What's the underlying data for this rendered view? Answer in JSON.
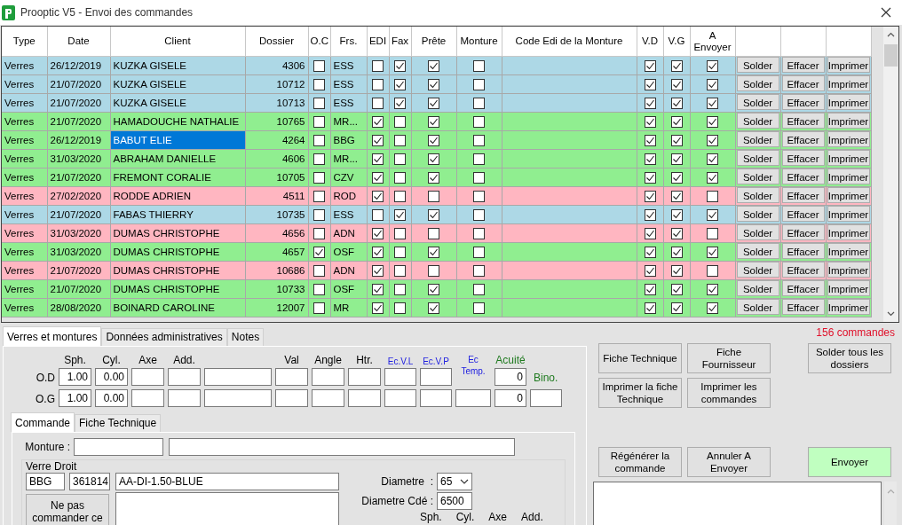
{
  "window": {
    "title": "Prooptic V5 - Envoi des commandes"
  },
  "table": {
    "columns": [
      "Type",
      "Date",
      "Client",
      "Dossier",
      "O.C",
      "Frs.",
      "EDI",
      "Fax",
      "Prête",
      "Monture",
      "Code Edi de la Monture",
      "V.D",
      "V.G",
      "A Envoyer"
    ],
    "rows": [
      {
        "type": "Verres",
        "date": "26/12/2019",
        "client": "KUZKA GISELE",
        "dossier": "4306",
        "oc": false,
        "frs": "ESS",
        "edi": false,
        "fax": true,
        "prete": true,
        "monture": false,
        "vd": true,
        "vg": true,
        "a_envoyer": true,
        "color": "#add8e6",
        "selected": false,
        "buttons": [
          "Solder",
          "Effacer",
          "Imprimer"
        ]
      },
      {
        "type": "Verres",
        "date": "21/07/2020",
        "client": "KUZKA GISELE",
        "dossier": "10712",
        "oc": false,
        "frs": "ESS",
        "edi": false,
        "fax": true,
        "prete": true,
        "monture": false,
        "vd": true,
        "vg": true,
        "a_envoyer": true,
        "color": "#add8e6",
        "selected": false,
        "buttons": [
          "Solder",
          "Effacer",
          "Imprimer"
        ]
      },
      {
        "type": "Verres",
        "date": "21/07/2020",
        "client": "KUZKA GISELE",
        "dossier": "10713",
        "oc": false,
        "frs": "ESS",
        "edi": false,
        "fax": true,
        "prete": true,
        "monture": false,
        "vd": true,
        "vg": true,
        "a_envoyer": true,
        "color": "#add8e6",
        "selected": false,
        "buttons": [
          "Solder",
          "Effacer",
          "Imprimer"
        ]
      },
      {
        "type": "Verres",
        "date": "21/07/2020",
        "client": "HAMADOUCHE NATHALIE",
        "dossier": "10765",
        "oc": false,
        "frs": "MR...",
        "edi": true,
        "fax": false,
        "prete": true,
        "monture": false,
        "vd": true,
        "vg": true,
        "a_envoyer": true,
        "color": "#90ee90",
        "selected": false,
        "buttons": [
          "Solder",
          "Effacer",
          "Imprimer"
        ]
      },
      {
        "type": "Verres",
        "date": "26/12/2019",
        "client": "BABUT ELIE",
        "dossier": "4264",
        "oc": false,
        "frs": "BBG",
        "edi": true,
        "fax": false,
        "prete": true,
        "monture": false,
        "vd": true,
        "vg": true,
        "a_envoyer": true,
        "color": "#90ee90",
        "selected": true,
        "buttons": [
          "Solder",
          "Effacer",
          "Imprimer"
        ]
      },
      {
        "type": "Verres",
        "date": "31/03/2020",
        "client": "ABRAHAM DANIELLE",
        "dossier": "4606",
        "oc": false,
        "frs": "MR...",
        "edi": true,
        "fax": false,
        "prete": true,
        "monture": false,
        "vd": true,
        "vg": true,
        "a_envoyer": true,
        "color": "#90ee90",
        "selected": false,
        "buttons": [
          "Solder",
          "Effacer",
          "Imprimer"
        ]
      },
      {
        "type": "Verres",
        "date": "21/07/2020",
        "client": "FREMONT CORALIE",
        "dossier": "10705",
        "oc": false,
        "frs": "CZV",
        "edi": true,
        "fax": false,
        "prete": true,
        "monture": false,
        "vd": true,
        "vg": true,
        "a_envoyer": true,
        "color": "#90ee90",
        "selected": false,
        "buttons": [
          "Solder",
          "Effacer",
          "Imprimer"
        ]
      },
      {
        "type": "Verres",
        "date": "27/02/2020",
        "client": "RODDE ADRIEN",
        "dossier": "4511",
        "oc": false,
        "frs": "ROD",
        "edi": true,
        "fax": false,
        "prete": false,
        "monture": false,
        "vd": true,
        "vg": true,
        "a_envoyer": false,
        "color": "#ffb6c1",
        "selected": false,
        "buttons": [
          "Solder",
          "Effacer",
          "Imprimer"
        ]
      },
      {
        "type": "Verres",
        "date": "21/07/2020",
        "client": "FABAS THIERRY",
        "dossier": "10735",
        "oc": false,
        "frs": "ESS",
        "edi": false,
        "fax": true,
        "prete": true,
        "monture": false,
        "vd": true,
        "vg": true,
        "a_envoyer": true,
        "color": "#add8e6",
        "selected": false,
        "buttons": [
          "Solder",
          "Effacer",
          "Imprimer"
        ]
      },
      {
        "type": "Verres",
        "date": "31/03/2020",
        "client": "DUMAS CHRISTOPHE",
        "dossier": "4656",
        "oc": false,
        "frs": "ADN",
        "edi": true,
        "fax": false,
        "prete": false,
        "monture": false,
        "vd": true,
        "vg": true,
        "a_envoyer": false,
        "color": "#ffb6c1",
        "selected": false,
        "buttons": [
          "Solder",
          "Effacer",
          "Imprimer"
        ]
      },
      {
        "type": "Verres",
        "date": "31/03/2020",
        "client": "DUMAS CHRISTOPHE",
        "dossier": "4657",
        "oc": true,
        "frs": "OSF",
        "edi": true,
        "fax": false,
        "prete": true,
        "monture": false,
        "vd": true,
        "vg": true,
        "a_envoyer": true,
        "color": "#90ee90",
        "selected": false,
        "buttons": [
          "Solder",
          "Effacer",
          "Imprimer"
        ]
      },
      {
        "type": "Verres",
        "date": "21/07/2020",
        "client": "DUMAS CHRISTOPHE",
        "dossier": "10686",
        "oc": false,
        "frs": "ADN",
        "edi": true,
        "fax": false,
        "prete": false,
        "monture": false,
        "vd": true,
        "vg": true,
        "a_envoyer": false,
        "color": "#ffb6c1",
        "selected": false,
        "buttons": [
          "Solder",
          "Effacer",
          "Imprimer"
        ]
      },
      {
        "type": "Verres",
        "date": "21/07/2020",
        "client": "DUMAS CHRISTOPHE",
        "dossier": "10733",
        "oc": false,
        "frs": "OSF",
        "edi": true,
        "fax": false,
        "prete": true,
        "monture": false,
        "vd": true,
        "vg": true,
        "a_envoyer": true,
        "color": "#90ee90",
        "selected": false,
        "buttons": [
          "Solder",
          "Effacer",
          "Imprimer"
        ]
      },
      {
        "type": "Verres",
        "date": "28/08/2020",
        "client": "BOINARD CAROLINE",
        "dossier": "12007",
        "oc": false,
        "frs": "MR",
        "edi": true,
        "fax": false,
        "prete": true,
        "monture": false,
        "vd": true,
        "vg": true,
        "a_envoyer": true,
        "color": "#90ee90",
        "selected": false,
        "buttons": [
          "Solder",
          "Effacer",
          "Imprimer"
        ]
      }
    ]
  },
  "tabs": [
    {
      "label": "Verres et montures",
      "selected": true
    },
    {
      "label": "Données administratives",
      "selected": false
    },
    {
      "label": "Notes",
      "selected": false
    }
  ],
  "count": "156 commandes",
  "prescription": {
    "headers": [
      {
        "label": "Sph.",
        "kind": "normal"
      },
      {
        "label": "Cyl.",
        "kind": "normal"
      },
      {
        "label": "Axe",
        "kind": "normal"
      },
      {
        "label": "Add.",
        "kind": "normal"
      },
      {
        "label": "Val",
        "kind": "normal"
      },
      {
        "label": "Angle",
        "kind": "normal"
      },
      {
        "label": "Htr.",
        "kind": "normal"
      },
      {
        "label": "Ec.V.L",
        "kind": "ecart"
      },
      {
        "label": "Ec.V.P",
        "kind": "ecart"
      },
      {
        "label": "Ec Temp.",
        "kind": "ecart"
      },
      {
        "label": "Acuité",
        "kind": "acuite"
      }
    ],
    "rows": [
      {
        "eye": "O.D",
        "sph": "1.00",
        "cyl": "0.00",
        "acuite": "0",
        "ec_temp_field": false,
        "bino": "Bino."
      },
      {
        "eye": "O.G",
        "sph": "1.00",
        "cyl": "0.00",
        "acuite": "0",
        "ec_temp_field": true
      }
    ]
  },
  "subtabs": [
    {
      "label": "Commande",
      "selected": true
    },
    {
      "label": "Fiche Technique",
      "selected": false
    }
  ],
  "monture_label": "Monture :",
  "verre_droit": {
    "title": "Verre Droit",
    "supplier": "BBG",
    "code": "361814",
    "name": "AA-DI-1.50-BLUE",
    "diametre_label": "Diametre  :",
    "diametre": "65",
    "diametre_cde_label": "Diametre Cdé :",
    "diametre_cde": "6500",
    "button": "Ne pas commander ce",
    "headers": [
      "Sph.",
      "Cyl.",
      "Axe",
      "Add."
    ]
  },
  "actions": [
    [
      {
        "label": "Fiche Technique",
        "kind": "normal"
      },
      {
        "label": "Fiche Fournisseur",
        "kind": "normal"
      },
      {
        "label": "Solder tous les dossiers",
        "kind": "normal"
      }
    ],
    [
      {
        "label": "Imprimer la fiche Technique",
        "kind": "normal"
      },
      {
        "label": "Imprimer les commandes",
        "kind": "normal"
      }
    ],
    [
      {
        "label": "Régénérer la commande",
        "kind": "normal"
      },
      {
        "label": "Annuler A Envoyer",
        "kind": "normal"
      },
      {
        "label": "Envoyer",
        "kind": "primary"
      }
    ]
  ]
}
